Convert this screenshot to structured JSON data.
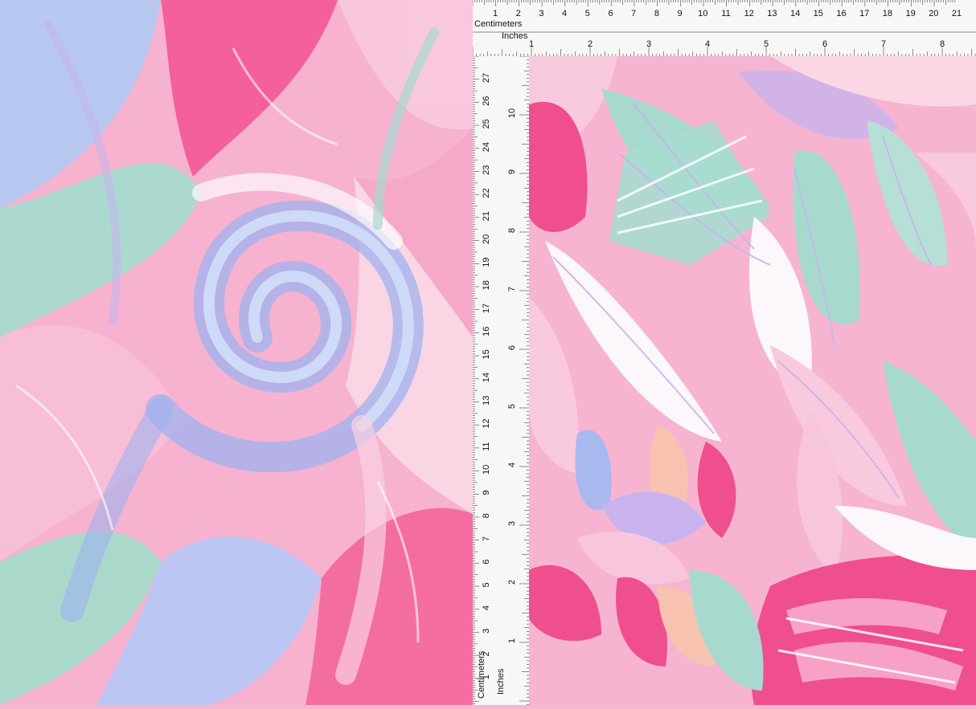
{
  "ruler": {
    "cm_label": "Centimeters",
    "inch_label": "Inches",
    "cm_ticks_top": [
      "1",
      "2",
      "3",
      "4",
      "5",
      "6",
      "7",
      "8",
      "9",
      "10",
      "11",
      "12",
      "13",
      "14",
      "15",
      "16",
      "17",
      "18",
      "19",
      "20",
      "21"
    ],
    "inch_ticks_top": [
      "1",
      "2",
      "3",
      "4",
      "5",
      "6",
      "7",
      "8"
    ],
    "cm_ticks_left": [
      "27",
      "26",
      "25",
      "24",
      "23",
      "22",
      "21",
      "20",
      "19",
      "18",
      "17",
      "16",
      "15",
      "14",
      "13",
      "12",
      "11",
      "10",
      "9",
      "8",
      "7",
      "6",
      "5",
      "4",
      "3",
      "2",
      "1"
    ],
    "inch_ticks_left": [
      "10",
      "9",
      "8",
      "7",
      "6",
      "5",
      "4",
      "3",
      "2",
      "1"
    ]
  },
  "palette": {
    "pink": "#f49ac2",
    "hot_pink": "#ef4f8e",
    "light_pink": "#f8c6dc",
    "mint": "#a7d9cf",
    "periwinkle": "#aab8f0",
    "lavender": "#c9b3ee",
    "white": "#fbf7fb",
    "peach": "#f7c3b0"
  }
}
